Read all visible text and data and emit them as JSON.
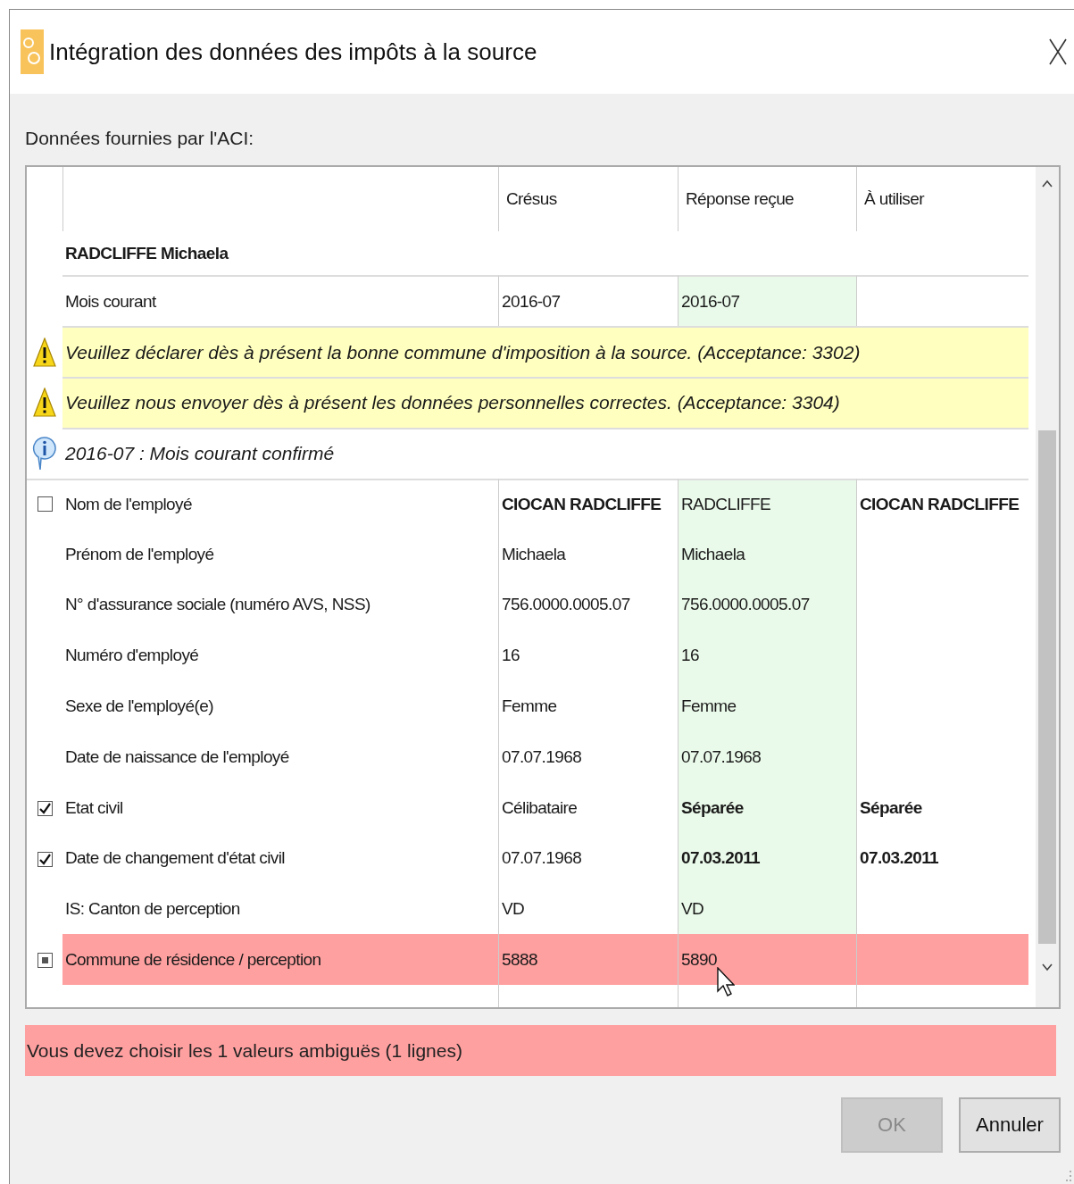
{
  "window": {
    "title": "Intégration des données des impôts à la source"
  },
  "section_label": "Données fournies par l'ACI:",
  "table": {
    "columns": [
      "Crésus",
      "Réponse reçue",
      "À utiliser"
    ],
    "person": "RADCLIFFE Michaela",
    "month_row": {
      "label": "Mois courant",
      "cresus": "2016-07",
      "reponse": "2016-07"
    },
    "messages": [
      {
        "kind": "warning",
        "text": "Veuillez déclarer dès à présent la bonne commune d'imposition à la source. (Acceptance: 3302)"
      },
      {
        "kind": "warning",
        "text": "Veuillez nous envoyer dès à présent les données personnelles correctes. (Acceptance: 3304)"
      },
      {
        "kind": "info",
        "text": "2016-07 : Mois courant confirmé"
      }
    ],
    "rows": [
      {
        "label": "Nom de l'employé",
        "kind": "checkbox",
        "checked": false,
        "ambiguous": false,
        "cells": [
          {
            "text": "CIOCAN RADCLIFFE",
            "emphasized": true
          },
          {
            "text": "RADCLIFFE",
            "emphasized": false
          },
          {
            "text": "CIOCAN RADCLIFFE",
            "emphasized": true
          }
        ]
      },
      {
        "label": "Prénom de l'employé",
        "kind": "plain",
        "ambiguous": false,
        "cells": [
          {
            "text": "Michaela",
            "emphasized": false
          },
          {
            "text": "Michaela",
            "emphasized": false
          }
        ]
      },
      {
        "label": "N° d'assurance sociale (numéro AVS, NSS)",
        "kind": "plain",
        "ambiguous": false,
        "cells": [
          {
            "text": "756.0000.0005.07",
            "emphasized": false
          },
          {
            "text": "756.0000.0005.07",
            "emphasized": false
          }
        ]
      },
      {
        "label": "Numéro d'employé",
        "kind": "plain",
        "ambiguous": false,
        "cells": [
          {
            "text": "16",
            "emphasized": false
          },
          {
            "text": "16",
            "emphasized": false
          }
        ]
      },
      {
        "label": "Sexe de l'employé(e)",
        "kind": "plain",
        "ambiguous": false,
        "cells": [
          {
            "text": "Femme",
            "emphasized": false
          },
          {
            "text": "Femme",
            "emphasized": false
          }
        ]
      },
      {
        "label": "Date de naissance de l'employé",
        "kind": "plain",
        "ambiguous": false,
        "cells": [
          {
            "text": "07.07.1968",
            "emphasized": false
          },
          {
            "text": "07.07.1968",
            "emphasized": false
          }
        ]
      },
      {
        "label": "Etat civil",
        "kind": "checkbox",
        "checked": true,
        "ambiguous": false,
        "cells": [
          {
            "text": "Célibataire",
            "emphasized": false
          },
          {
            "text": "Séparée",
            "emphasized": true
          },
          {
            "text": "Séparée",
            "emphasized": true
          }
        ]
      },
      {
        "label": "Date de changement d'état civil",
        "kind": "checkbox",
        "checked": true,
        "ambiguous": false,
        "cells": [
          {
            "text": "07.07.1968",
            "emphasized": false
          },
          {
            "text": "07.03.2011",
            "emphasized": true
          },
          {
            "text": "07.03.2011",
            "emphasized": true
          }
        ]
      },
      {
        "label": "IS: Canton de perception",
        "kind": "plain",
        "ambiguous": false,
        "cells": [
          {
            "text": "VD",
            "emphasized": false
          },
          {
            "text": "VD",
            "emphasized": false
          }
        ]
      },
      {
        "label": "Commune de résidence / perception",
        "kind": "mixed-checkbox",
        "ambiguous": true,
        "cells": [
          {
            "text": "5888",
            "emphasized": false
          },
          {
            "text": "5890",
            "emphasized": false
          }
        ]
      }
    ]
  },
  "status_message": "Vous devez choisir les 1 valeurs ambiguës (1 lignes)",
  "buttons": [
    {
      "label": "OK",
      "disabled": true
    },
    {
      "label": "Annuler",
      "disabled": false
    }
  ]
}
